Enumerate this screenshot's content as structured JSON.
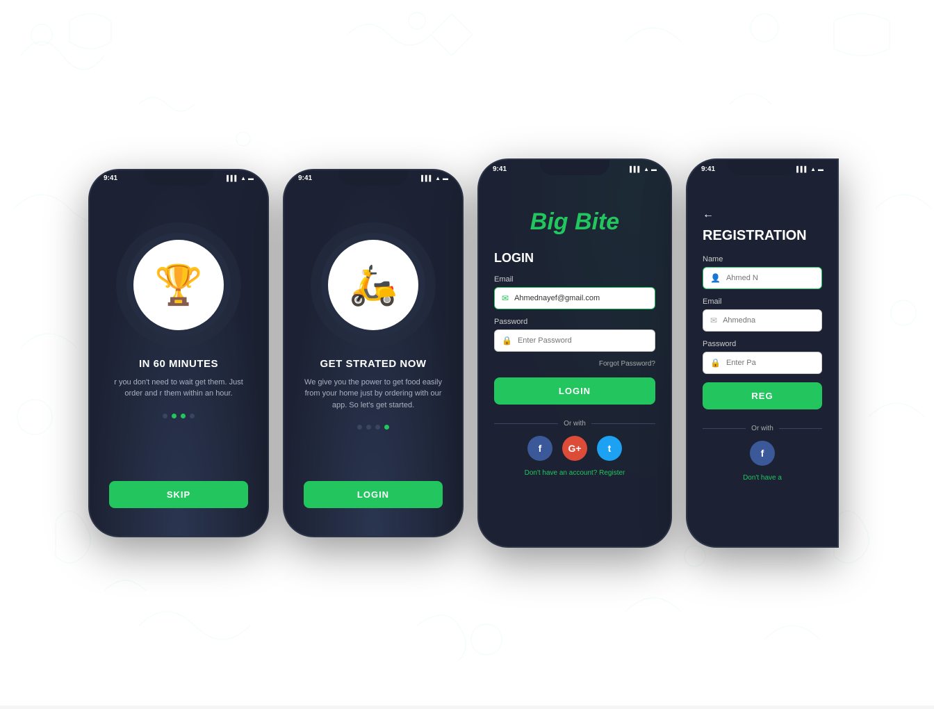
{
  "background": {
    "color": "#ffffff"
  },
  "phones": [
    {
      "id": "phone-1",
      "time": "9:41",
      "type": "onboarding-1",
      "illustration": "🏆",
      "title": "IN 60 MINUTES",
      "desc": "r you don't need to wait get them. Just order and r them within an hour.",
      "dots": [
        false,
        true,
        true,
        false
      ],
      "button": "SKIP"
    },
    {
      "id": "phone-2",
      "time": "9:41",
      "type": "onboarding-2",
      "illustration": "🛵",
      "title": "GET STRATED NOW",
      "desc": "We give you the power to get food easily from your home just by ordering with our app. So let's get started.",
      "dots": [
        false,
        false,
        false,
        true
      ],
      "button": "LOGIN"
    },
    {
      "id": "phone-3",
      "time": "9:41",
      "type": "login",
      "app_title": "Big Bite",
      "login_label": "LOGIN",
      "email_label": "Email",
      "email_value": "Ahmednayef@gmail.com",
      "password_label": "Password",
      "password_placeholder": "Enter Password",
      "forgot_pw": "Forgot Password?",
      "login_button": "LOGIN",
      "or_with": "Or with",
      "dont_have": "Don't have an account?",
      "register_link": "Register"
    },
    {
      "id": "phone-4",
      "time": "9:41",
      "type": "registration",
      "back_arrow": "←",
      "reg_title": "REGISTRATION",
      "name_label": "Name",
      "name_placeholder": "Ahmed N",
      "email_label": "Email",
      "email_placeholder": "Ahmedna",
      "password_label": "Password",
      "password_placeholder": "Enter Pa",
      "reg_button": "REG",
      "dont_have": "Don't have a",
      "fb_social": "f"
    }
  ]
}
